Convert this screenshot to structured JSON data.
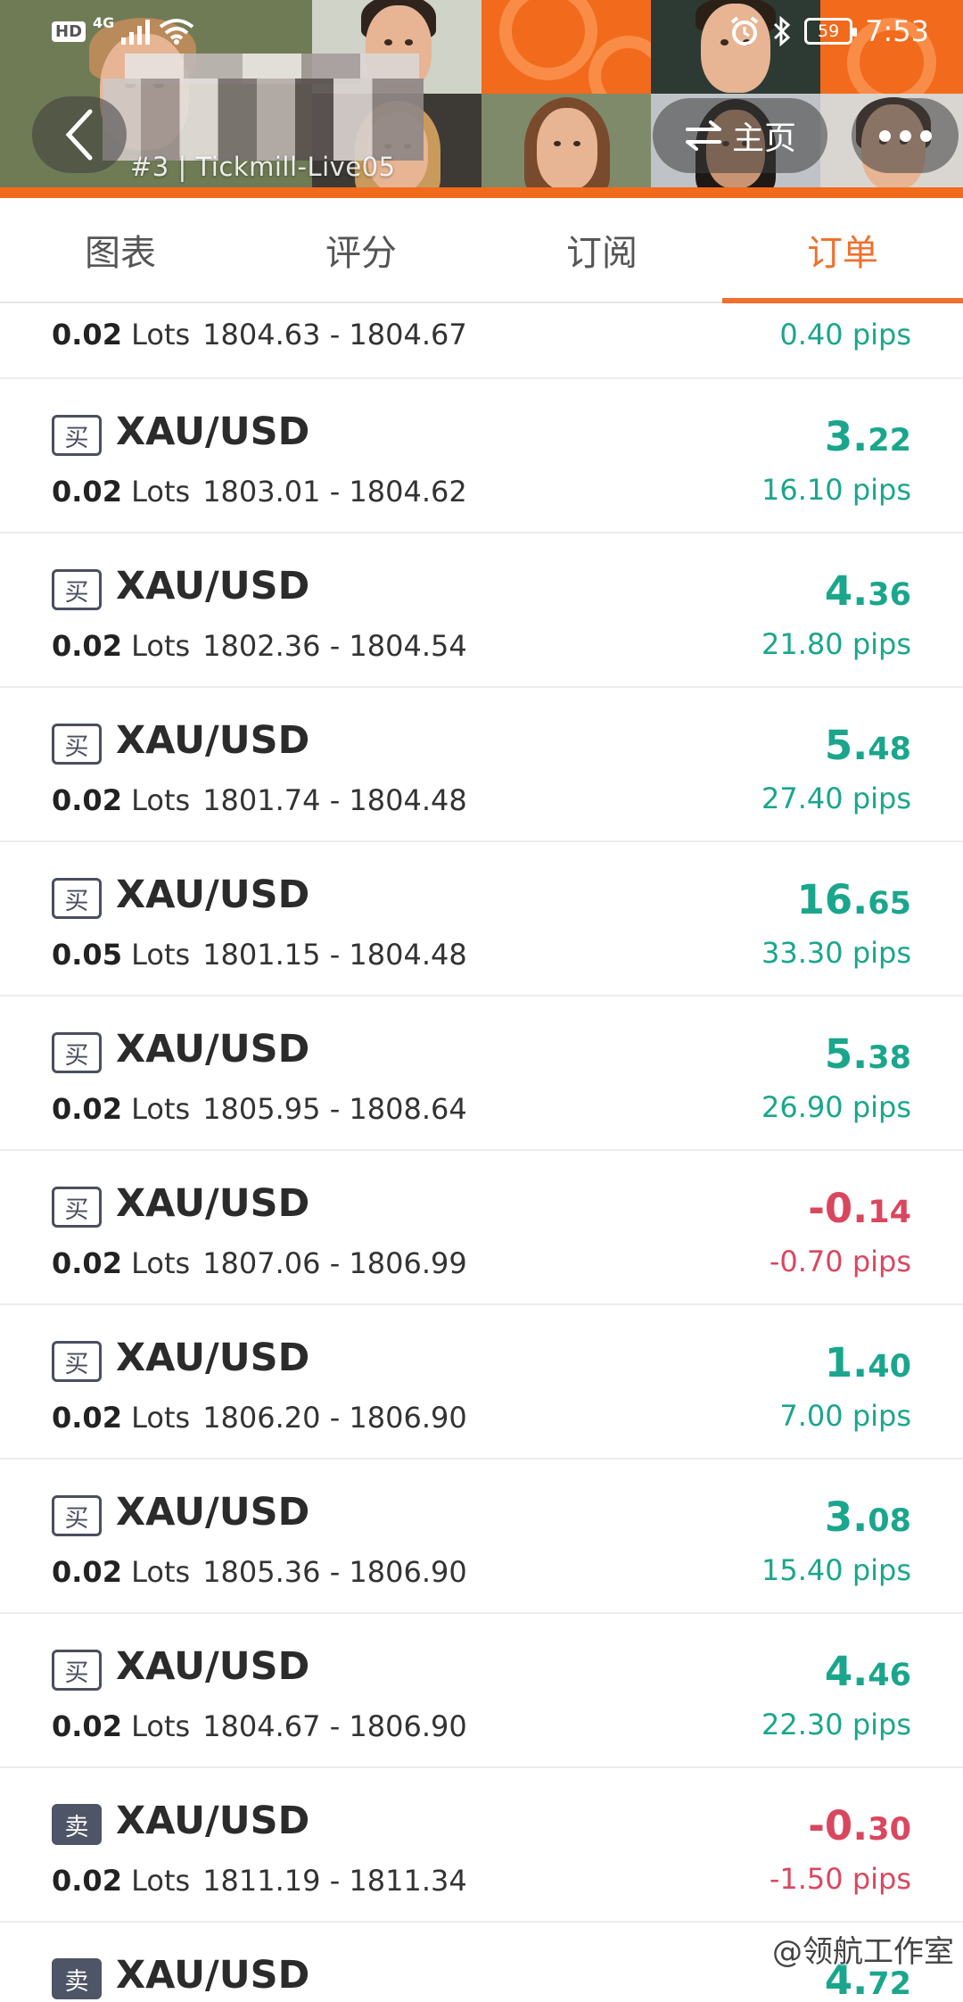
{
  "status_bar": {
    "network_badge": "HD",
    "network_type": "4G",
    "battery": "59",
    "time": "7:53"
  },
  "header": {
    "account_label": "#3 | Tickmill-Live05",
    "home_label": "主页",
    "accent_color": "#f26a1b"
  },
  "tabs": [
    {
      "label": "图表",
      "active": false
    },
    {
      "label": "评分",
      "active": false
    },
    {
      "label": "订阅",
      "active": false
    },
    {
      "label": "订单",
      "active": true
    }
  ],
  "orders": [
    {
      "partial": true,
      "side": "",
      "symbol": "",
      "lots": "0.02",
      "lots_unit": "Lots",
      "range": "1804.63 - 1804.67",
      "profit_int": "",
      "profit_dec": "",
      "pips": "0.40 pips",
      "positive": true
    },
    {
      "partial": false,
      "side": "买",
      "symbol": "XAU/USD",
      "lots": "0.02",
      "lots_unit": "Lots",
      "range": "1803.01 - 1804.62",
      "profit_int": "3.",
      "profit_dec": "22",
      "pips": "16.10 pips",
      "positive": true
    },
    {
      "partial": false,
      "side": "买",
      "symbol": "XAU/USD",
      "lots": "0.02",
      "lots_unit": "Lots",
      "range": "1802.36 - 1804.54",
      "profit_int": "4.",
      "profit_dec": "36",
      "pips": "21.80 pips",
      "positive": true
    },
    {
      "partial": false,
      "side": "买",
      "symbol": "XAU/USD",
      "lots": "0.02",
      "lots_unit": "Lots",
      "range": "1801.74 - 1804.48",
      "profit_int": "5.",
      "profit_dec": "48",
      "pips": "27.40 pips",
      "positive": true
    },
    {
      "partial": false,
      "side": "买",
      "symbol": "XAU/USD",
      "lots": "0.05",
      "lots_unit": "Lots",
      "range": "1801.15 - 1804.48",
      "profit_int": "16.",
      "profit_dec": "65",
      "pips": "33.30 pips",
      "positive": true
    },
    {
      "partial": false,
      "side": "买",
      "symbol": "XAU/USD",
      "lots": "0.02",
      "lots_unit": "Lots",
      "range": "1805.95 - 1808.64",
      "profit_int": "5.",
      "profit_dec": "38",
      "pips": "26.90 pips",
      "positive": true
    },
    {
      "partial": false,
      "side": "买",
      "symbol": "XAU/USD",
      "lots": "0.02",
      "lots_unit": "Lots",
      "range": "1807.06 - 1806.99",
      "profit_int": "-0.",
      "profit_dec": "14",
      "pips": "-0.70 pips",
      "positive": false
    },
    {
      "partial": false,
      "side": "买",
      "symbol": "XAU/USD",
      "lots": "0.02",
      "lots_unit": "Lots",
      "range": "1806.20 - 1806.90",
      "profit_int": "1.",
      "profit_dec": "40",
      "pips": "7.00 pips",
      "positive": true
    },
    {
      "partial": false,
      "side": "买",
      "symbol": "XAU/USD",
      "lots": "0.02",
      "lots_unit": "Lots",
      "range": "1805.36 - 1806.90",
      "profit_int": "3.",
      "profit_dec": "08",
      "pips": "15.40 pips",
      "positive": true
    },
    {
      "partial": false,
      "side": "买",
      "symbol": "XAU/USD",
      "lots": "0.02",
      "lots_unit": "Lots",
      "range": "1804.67 - 1806.90",
      "profit_int": "4.",
      "profit_dec": "46",
      "pips": "22.30 pips",
      "positive": true
    },
    {
      "partial": false,
      "side": "卖",
      "symbol": "XAU/USD",
      "lots": "0.02",
      "lots_unit": "Lots",
      "range": "1811.19 - 1811.34",
      "profit_int": "-0.",
      "profit_dec": "30",
      "pips": "-1.50 pips",
      "positive": false
    },
    {
      "partial": false,
      "side": "卖",
      "symbol": "XAU/USD",
      "lots": "",
      "lots_unit": "",
      "range": "",
      "profit_int": "4.",
      "profit_dec": "72",
      "pips": "",
      "positive": true
    }
  ],
  "colors": {
    "positive": "#1aa68c",
    "negative": "#d9475f",
    "active_tab": "#f0702d"
  },
  "watermark": "@领航工作室"
}
